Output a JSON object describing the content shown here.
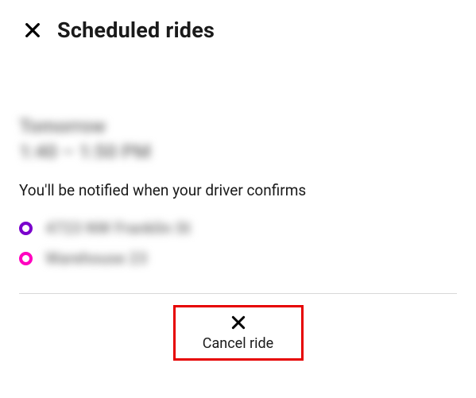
{
  "header": {
    "title": "Scheduled rides"
  },
  "ride": {
    "date": "Tomorrow",
    "time": "1:40 – 1:50 PM",
    "note": "You'll be notified when your driver confirms",
    "pickup": "4723 NW Franklin St",
    "dropoff": "Warehouse 23"
  },
  "actions": {
    "cancel_label": "Cancel ride"
  }
}
